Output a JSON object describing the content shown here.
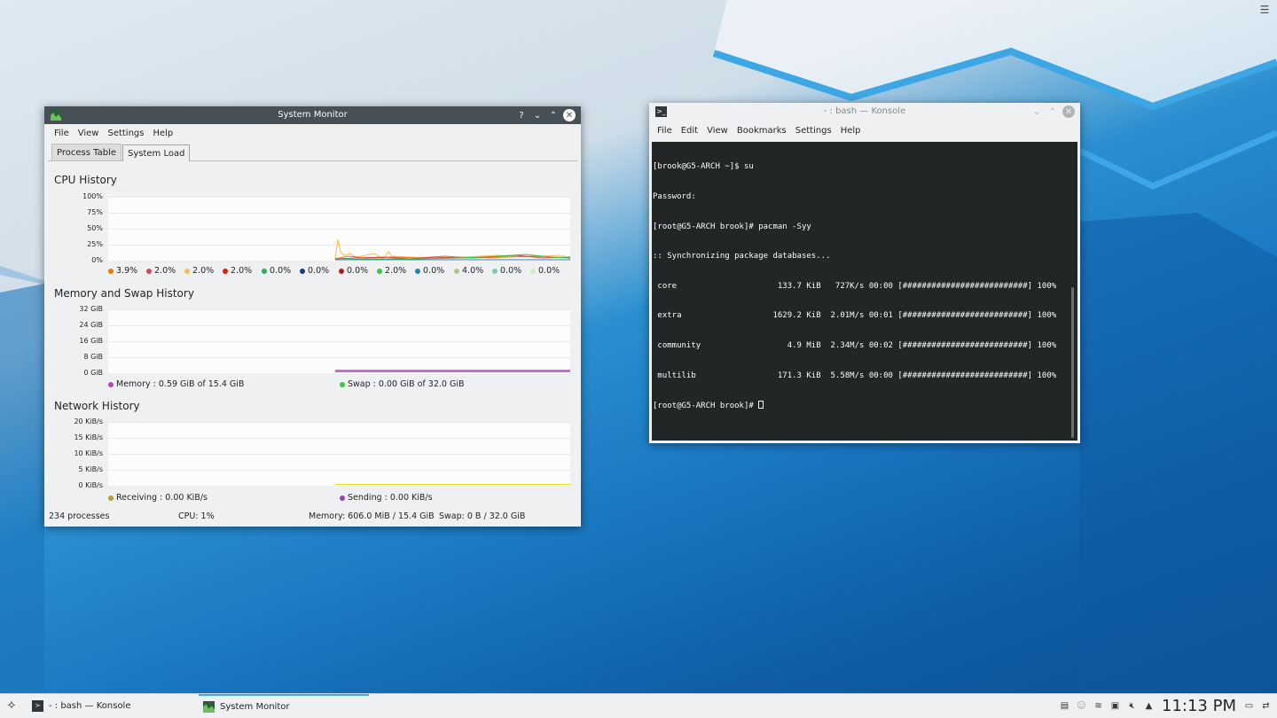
{
  "desktop": {
    "menu_icon": "hamburger-menu-icon"
  },
  "sysmon": {
    "title": "System Monitor",
    "titlebar_buttons": {
      "help": "?",
      "minimize": "⌄",
      "maximize": "⌃",
      "close": "✕"
    },
    "menu": [
      "File",
      "View",
      "Settings",
      "Help"
    ],
    "tabs": [
      "Process Table",
      "System Load"
    ],
    "active_tab": "System Load",
    "cpu": {
      "title": "CPU History",
      "y_ticks": [
        "100%",
        "75%",
        "50%",
        "25%",
        "0%"
      ],
      "legend": [
        {
          "value": "3.9%",
          "color": "#f67400"
        },
        {
          "value": "2.0%",
          "color": "#da4453"
        },
        {
          "value": "2.0%",
          "color": "#fdbc4b"
        },
        {
          "value": "2.0%",
          "color": "#e8170b"
        },
        {
          "value": "0.0%",
          "color": "#27ae60"
        },
        {
          "value": "0.0%",
          "color": "#1d3b8d"
        },
        {
          "value": "0.0%",
          "color": "#a9211d"
        },
        {
          "value": "2.0%",
          "color": "#2ecc40"
        },
        {
          "value": "0.0%",
          "color": "#2980b9"
        },
        {
          "value": "4.0%",
          "color": "#b3c480"
        },
        {
          "value": "0.0%",
          "color": "#7fc8b4"
        },
        {
          "value": "0.0%",
          "color": "#cef0c0"
        }
      ]
    },
    "memory": {
      "title": "Memory and Swap History",
      "y_ticks": [
        "32 GiB",
        "24 GiB",
        "16 GiB",
        "8 GiB",
        "0 GiB"
      ],
      "legend": [
        {
          "label": "Memory : 0.59 GiB of 15.4 GiB",
          "color": "#c03ec0"
        },
        {
          "label": "Swap : 0.00 GiB of 32.0 GiB",
          "color": "#2ecc40"
        }
      ]
    },
    "network": {
      "title": "Network History",
      "y_ticks": [
        "20 KiB/s",
        "15 KiB/s",
        "10 KiB/s",
        "5 KiB/s",
        "0 KiB/s"
      ],
      "legend": [
        {
          "label": "Receiving : 0.00 KiB/s",
          "color": "#b3a12e"
        },
        {
          "label": "Sending : 0.00 KiB/s",
          "color": "#9b3fb5"
        }
      ]
    },
    "status": {
      "processes": "234 processes",
      "cpu": "CPU: 1%",
      "memory": "Memory: 606.0 MiB / 15.4 GiB",
      "swap": "Swap: 0 B / 32.0 GiB"
    }
  },
  "konsole": {
    "title": "- : bash — Konsole",
    "menu": [
      "File",
      "Edit",
      "View",
      "Bookmarks",
      "Settings",
      "Help"
    ],
    "lines": [
      "[brook@G5-ARCH ~]$ su",
      "Password:",
      "[root@G5-ARCH brook]# pacman -Syy",
      ":: Synchronizing package databases...",
      " core                     133.7 KiB   727K/s 00:00 [##########################] 100%",
      " extra                   1629.2 KiB  2.01M/s 00:01 [##########################] 100%",
      " community                  4.9 MiB  2.34M/s 00:02 [##########################] 100%",
      " multilib                 171.3 KiB  5.58M/s 00:00 [##########################] 100%"
    ],
    "prompt": "[root@G5-ARCH brook]# "
  },
  "taskbar": {
    "tasks": [
      {
        "label": "- : bash — Konsole",
        "icon": "terminal-icon"
      },
      {
        "label": "System Monitor",
        "icon": "system-monitor-icon"
      }
    ],
    "clock": "11:13 PM"
  }
}
